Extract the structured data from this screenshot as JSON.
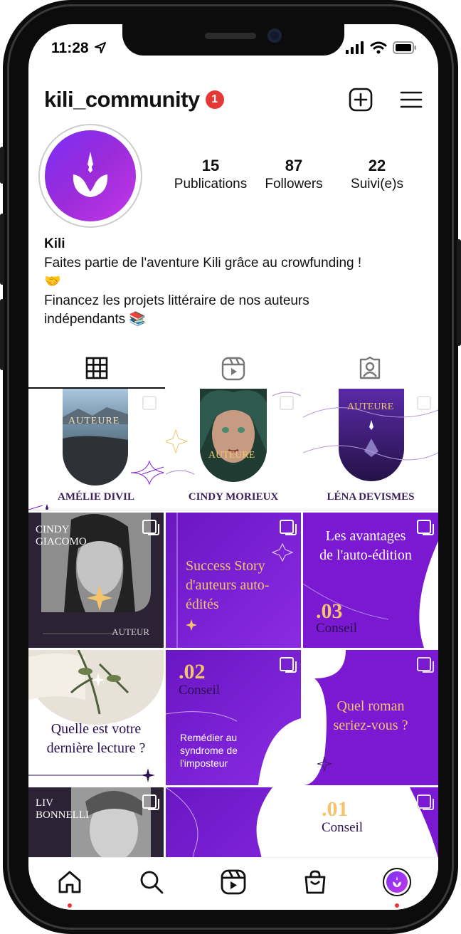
{
  "status": {
    "time": "11:28"
  },
  "profile": {
    "username": "kili_community",
    "notification_count": "1",
    "stats": [
      {
        "value": "15",
        "label": "Publications"
      },
      {
        "value": "87",
        "label": "Followers"
      },
      {
        "value": "22",
        "label": "Suivi(e)s"
      }
    ],
    "name": "Kili",
    "bio_line1": "Faites partie de l'aventure Kili grâce au crowfunding !",
    "bio_emoji1": "🤝",
    "bio_line2": "Financez les projets littéraire de nos auteurs",
    "bio_line3": "indépendants",
    "bio_emoji2": "📚"
  },
  "tabs": [
    "grid-icon",
    "reels-icon",
    "tagged-icon"
  ],
  "posts": [
    {
      "overlay": "AUTEURE",
      "caption": "AMÉLIE DIVIL"
    },
    {
      "overlay": "AUTEURE",
      "caption": "CINDY MORIEUX"
    },
    {
      "overlay": "AUTEURE",
      "caption": "LÉNA  DEVISMES"
    },
    {
      "name_line1": "CINDY",
      "name_line2": "GIACOMO",
      "overlay": "AUTEUR"
    },
    {
      "title": "Success Story d'auteurs auto-édités"
    },
    {
      "title_line1": "Les avantages",
      "title_line2": "de l'auto-édition",
      "number": ".03",
      "label": "Conseil"
    },
    {
      "title_line1": "Quelle est votre",
      "title_line2": "dernière lecture ?"
    },
    {
      "number": ".02",
      "label": "Conseil",
      "text_line1": "Remédier au",
      "text_line2": "syndrome de",
      "text_line3": "l'imposteur"
    },
    {
      "title_line1": "Quel roman",
      "title_line2": "seriez-vous ?"
    },
    {
      "name_line1": "LIV",
      "name_line2": "BONNELLI"
    },
    {},
    {
      "number": ".01",
      "label": "Conseil"
    }
  ],
  "colors": {
    "accent": "#7b1fd6",
    "gold": "#f2c46b",
    "notification": "#e53935"
  },
  "nav": [
    "home-icon",
    "search-icon",
    "reels-icon",
    "shop-icon",
    "profile-avatar"
  ]
}
